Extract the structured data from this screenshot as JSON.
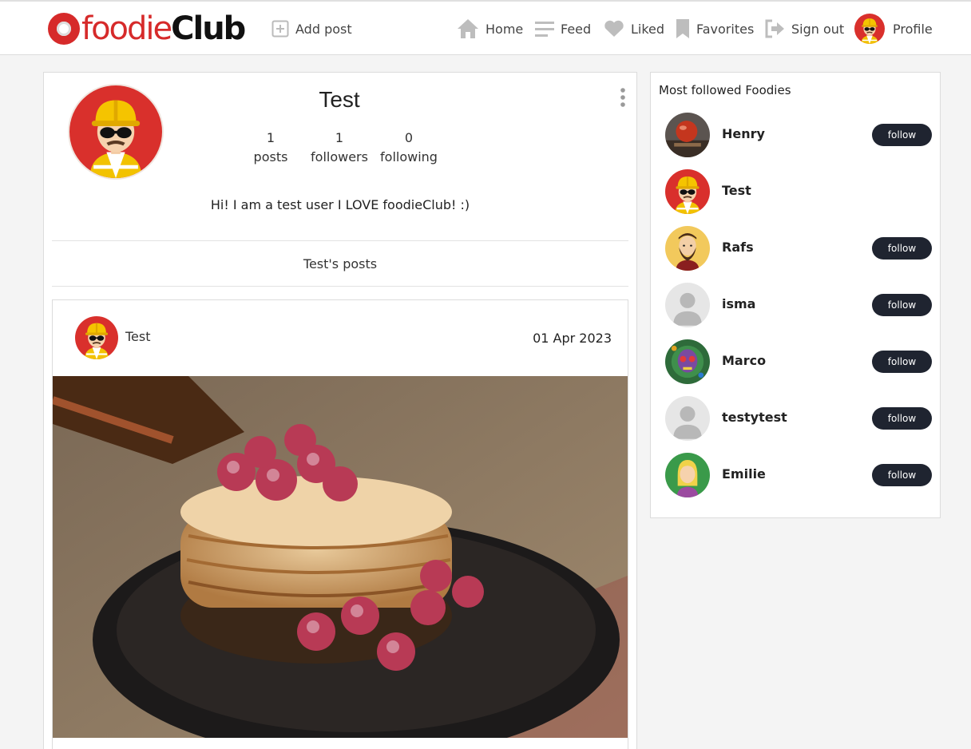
{
  "header": {
    "logo_foodie": "foodie",
    "logo_club": "Club",
    "add_post": "Add post",
    "home": "Home",
    "feed": "Feed",
    "liked": "Liked",
    "favorites": "Favorites",
    "sign_out": "Sign out",
    "profile": "Profile"
  },
  "profile": {
    "name": "Test",
    "posts_count": "1",
    "posts_label": "posts",
    "followers_count": "1",
    "followers_label": "followers",
    "following_count": "0",
    "following_label": "following",
    "bio": "Hi! I am a test user I LOVE foodieClub! :)",
    "posts_heading": "Test's posts"
  },
  "post": {
    "author": "Test",
    "date": "01 Apr 2023"
  },
  "sidebar": {
    "title": "Most followed Foodies",
    "follow_label": "follow",
    "foodies": [
      {
        "name": "Henry",
        "avatar": "food-photo",
        "followable": true
      },
      {
        "name": "Test",
        "avatar": "worker",
        "followable": false
      },
      {
        "name": "Rafs",
        "avatar": "bearded-man",
        "followable": true
      },
      {
        "name": "isma",
        "avatar": "default-user",
        "followable": true
      },
      {
        "name": "Marco",
        "avatar": "skull-art",
        "followable": true
      },
      {
        "name": "testytest",
        "avatar": "default-user",
        "followable": true
      },
      {
        "name": "Emilie",
        "avatar": "blonde-woman",
        "followable": true
      }
    ]
  },
  "colors": {
    "brand_red": "#d62a2a",
    "follow_button": "#1f2430",
    "background": "#f4f4f4"
  }
}
